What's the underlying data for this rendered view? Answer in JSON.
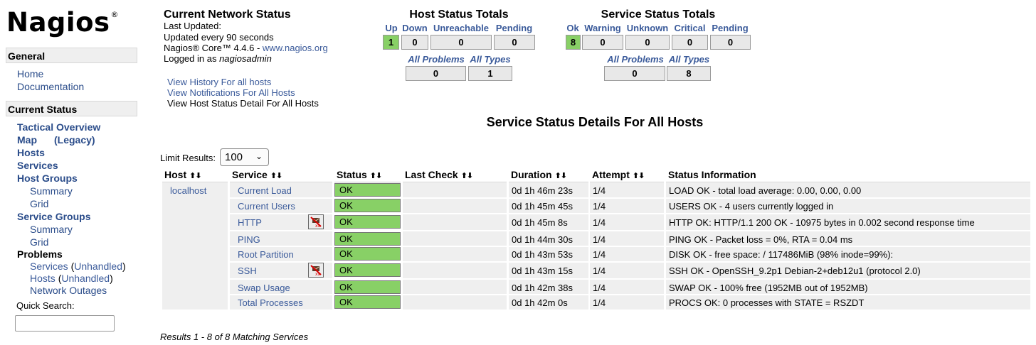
{
  "sidebar": {
    "logo": "Nagios",
    "logo_mark": "®",
    "general_heading": "General",
    "home": "Home",
    "documentation": "Documentation",
    "current_status_heading": "Current Status",
    "tactical_overview": "Tactical Overview",
    "map": "Map",
    "map_legacy": "(Legacy)",
    "hosts": "Hosts",
    "services": "Services",
    "host_groups": "Host Groups",
    "hg_summary": "Summary",
    "hg_grid": "Grid",
    "service_groups": "Service Groups",
    "sg_summary": "Summary",
    "sg_grid": "Grid",
    "problems": "Problems",
    "prob_services": "Services",
    "prob_services_unhandled": "Unhandled",
    "prob_hosts": "Hosts",
    "prob_hosts_unhandled": "Unhandled",
    "network_outages": "Network Outages",
    "quick_search_label": "Quick Search:"
  },
  "info": {
    "title": "Current Network Status",
    "last_updated": "Last Updated:",
    "update_interval": "Updated every 90 seconds",
    "version_prefix": "Nagios® Core™ 4.4.6 - ",
    "version_link": "www.nagios.org",
    "logged_in_prefix": "Logged in as ",
    "user": "nagiosadmin",
    "link_history": "View History For all hosts",
    "link_notifications": "View Notifications For All Hosts",
    "link_host_detail": "View Host Status Detail For All Hosts"
  },
  "host_totals": {
    "title": "Host Status Totals",
    "headers": [
      "Up",
      "Down",
      "Unreachable",
      "Pending"
    ],
    "values": [
      "1",
      "0",
      "0",
      "0"
    ],
    "sub_headers": [
      "All Problems",
      "All Types"
    ],
    "sub_values": [
      "0",
      "1"
    ]
  },
  "service_totals": {
    "title": "Service Status Totals",
    "headers": [
      "Ok",
      "Warning",
      "Unknown",
      "Critical",
      "Pending"
    ],
    "values": [
      "8",
      "0",
      "0",
      "0",
      "0"
    ],
    "sub_headers": [
      "All Problems",
      "All Types"
    ],
    "sub_values": [
      "0",
      "8"
    ]
  },
  "details": {
    "title": "Service Status Details For All Hosts",
    "limit_label": "Limit Results:",
    "limit_value": "100",
    "columns": [
      "Host",
      "Service",
      "Status",
      "Last Check",
      "Duration",
      "Attempt",
      "Status Information"
    ],
    "sort_glyph": "⬆⬇",
    "host": "localhost",
    "rows": [
      {
        "service": "Current Load",
        "status": "OK",
        "duration": "0d 1h 46m 23s",
        "attempt": "1/4",
        "info": "LOAD OK - total load average: 0.00, 0.00, 0.00"
      },
      {
        "service": "Current Users",
        "status": "OK",
        "duration": "0d 1h 45m 45s",
        "attempt": "1/4",
        "info": "USERS OK - 4 users currently logged in"
      },
      {
        "service": "HTTP",
        "status": "OK",
        "duration": "0d 1h 45m 8s",
        "attempt": "1/4",
        "info": "HTTP OK: HTTP/1.1 200 OK - 10975 bytes in 0.002 second response time"
      },
      {
        "service": "PING",
        "status": "OK",
        "duration": "0d 1h 44m 30s",
        "attempt": "1/4",
        "info": "PING OK - Packet loss = 0%, RTA = 0.04 ms"
      },
      {
        "service": "Root Partition",
        "status": "OK",
        "duration": "0d 1h 43m 53s",
        "attempt": "1/4",
        "info": "DISK OK - free space: / 117486MiB (98% inode=99%):"
      },
      {
        "service": "SSH",
        "status": "OK",
        "duration": "0d 1h 43m 15s",
        "attempt": "1/4",
        "info": "SSH OK - OpenSSH_9.2p1 Debian-2+deb12u1 (protocol 2.0)"
      },
      {
        "service": "Swap Usage",
        "status": "OK",
        "duration": "0d 1h 42m 38s",
        "attempt": "1/4",
        "info": "SWAP OK - 100% free (1952MB out of 1952MB)"
      },
      {
        "service": "Total Processes",
        "status": "OK",
        "duration": "0d 1h 42m 0s",
        "attempt": "1/4",
        "info": "PROCS OK: 0 processes with STATE = RSZDT"
      }
    ],
    "results_text": "Results 1 - 8 of 8 Matching Services"
  },
  "icons": {
    "notifications_disabled": "notifications-disabled-icon"
  },
  "colors": {
    "ok_green": "#88d066",
    "link_blue": "#3a5a9a",
    "row_gray": "#efefef"
  }
}
